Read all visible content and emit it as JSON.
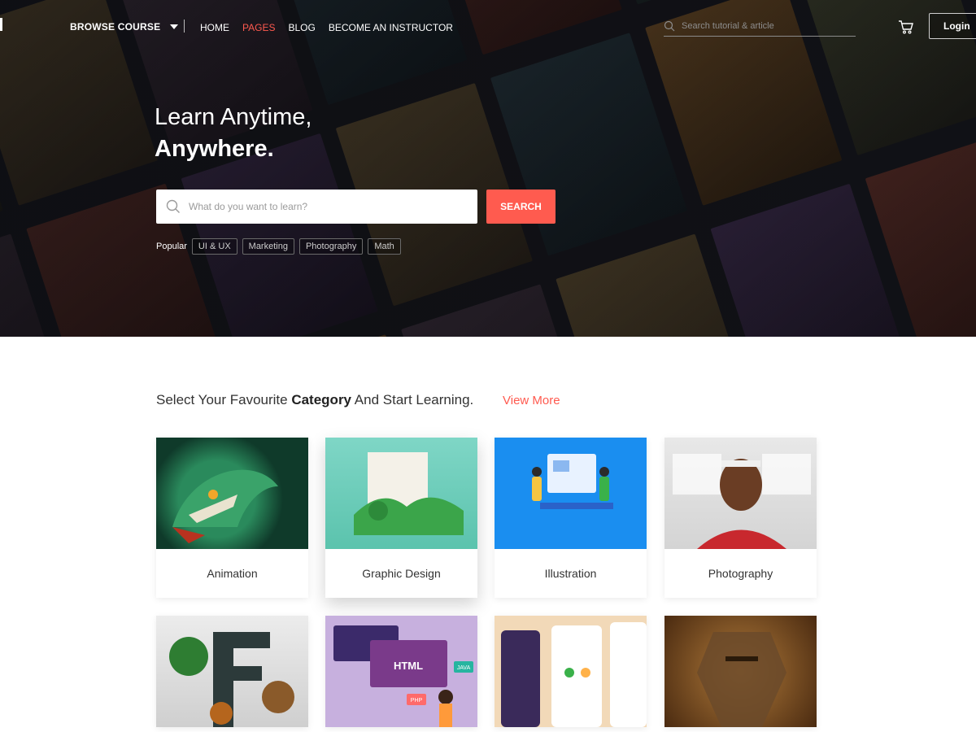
{
  "nav": {
    "browse_label": "BROWSE COURSE",
    "links": [
      "HOME",
      "PAGES",
      "BLOG",
      "BECOME AN INSTRUCTOR"
    ],
    "active_link": "PAGES",
    "search_placeholder": "Search tutorial & article",
    "login_label": "Login"
  },
  "hero": {
    "headline_line1": "Learn Anytime,",
    "headline_line2": "Anywhere.",
    "search_placeholder": "What do you want to learn?",
    "search_button": "SEARCH",
    "popular_label": "Popular",
    "popular_tags": [
      "UI & UX",
      "Marketing",
      "Photography",
      "Math"
    ]
  },
  "categories": {
    "title_prefix": "Select Your Favourite ",
    "title_bold": "Category",
    "title_suffix": " And Start Learning.",
    "view_more": "View More",
    "cards": [
      {
        "label": "Animation"
      },
      {
        "label": "Graphic Design"
      },
      {
        "label": "Illustration"
      },
      {
        "label": "Photography"
      }
    ],
    "row2_texts": {
      "html_label": "HTML",
      "java_label": "JAVA",
      "php_label": "PHP"
    }
  },
  "colors": {
    "accent": "#ff5a4f",
    "hero_bg": "#14151a"
  }
}
